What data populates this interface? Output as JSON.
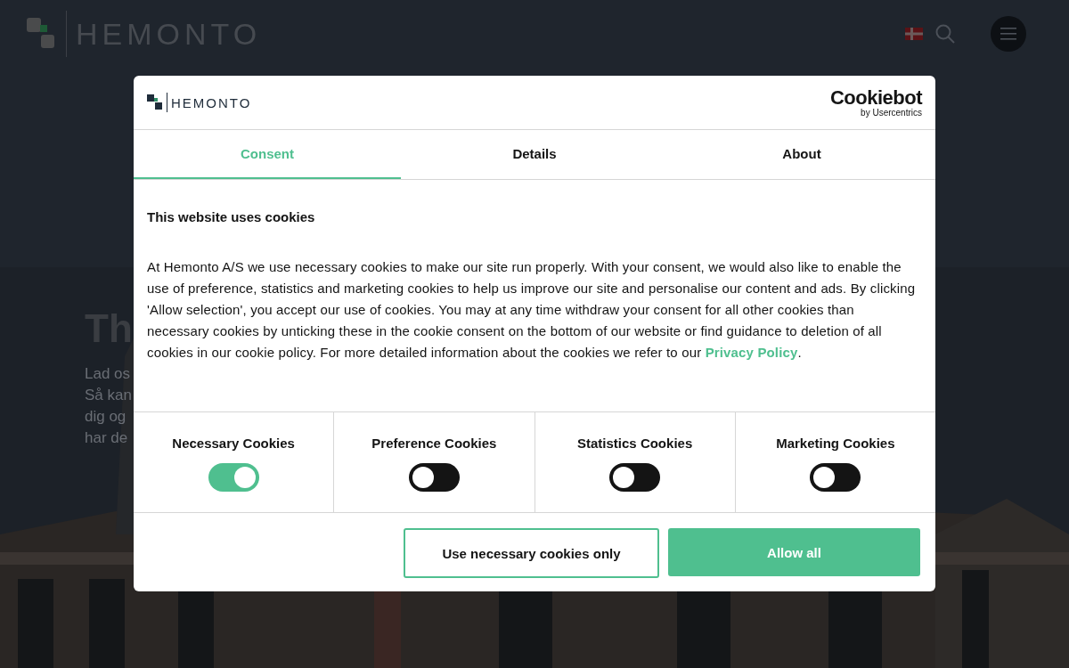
{
  "site": {
    "logo": "HEMONTO",
    "hero_title": "Th",
    "hero_lines": [
      "Lad os",
      "Så kan",
      "dig og",
      "har de"
    ]
  },
  "dialog": {
    "logo": "HEMONTO",
    "provider": "Cookiebot",
    "provider_sub": "by Usercentrics",
    "tabs": [
      {
        "label": "Consent",
        "selected": true
      },
      {
        "label": "Details",
        "selected": false
      },
      {
        "label": "About",
        "selected": false
      }
    ],
    "heading": "This website uses cookies",
    "body": "At Hemonto A/S we use necessary cookies to make our site run properly. With your consent, we would also like to enable the use of preference, statistics and marketing cookies to help us improve our site and personalise our content and ads. By clicking 'Allow selection', you accept our use of cookies. You may at any time withdraw your consent for all other cookies than necessary cookies by unticking these in the cookie consent on the bottom of our website or find guidance to deletion of all cookies in our cookie policy. For more detailed information about the cookies we refer to our",
    "link": "Privacy Policy",
    "body_end": ".",
    "categories": [
      {
        "label": "Necessary Cookies",
        "on": true
      },
      {
        "label": "Preference Cookies",
        "on": false
      },
      {
        "label": "Statistics Cookies",
        "on": false
      },
      {
        "label": "Marketing Cookies",
        "on": false
      }
    ],
    "buttons": [
      {
        "label": "Use necessary cookies only",
        "kind": "outline"
      },
      {
        "label": "Allow all",
        "kind": "primary"
      }
    ]
  }
}
